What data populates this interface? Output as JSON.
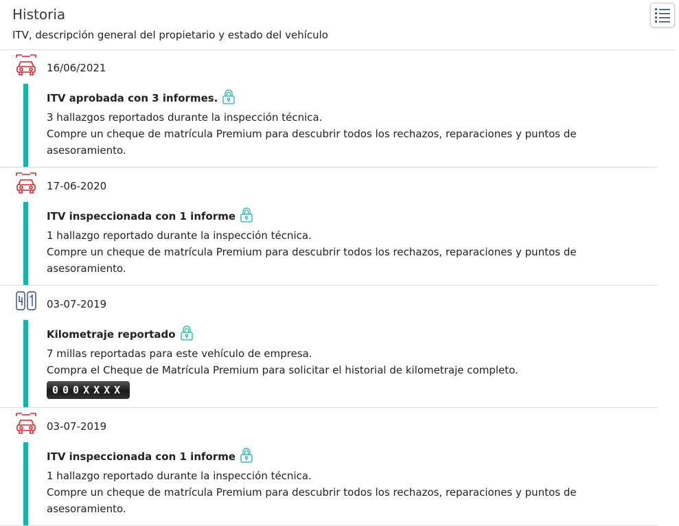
{
  "header": {
    "title": "Historia",
    "subtitle": "ITV, descripción general del propietario y estado del vehículo"
  },
  "colors": {
    "accent": "#1bb3a3",
    "icon_red": "#e0212a",
    "lock": "#1bb3a3"
  },
  "entries": [
    {
      "icon": "car-repair-icon",
      "date": "16/06/2021",
      "heading": "ITV aprobada con 3 informes.",
      "lines": [
        "3 hallazgos reportados durante la inspección técnica.",
        "Compre un cheque de matrícula Premium para descubrir todos los rechazos, reparaciones y puntos de asesoramiento."
      ]
    },
    {
      "icon": "car-repair-icon",
      "date": "17-06-2020",
      "heading": "ITV inspeccionada con 1 informe",
      "lines": [
        "1 hallazgo reportado durante la inspección técnica.",
        "Compre un cheque de matrícula Premium para descubrir todos los rechazos, reparaciones y puntos de asesoramiento."
      ]
    },
    {
      "icon": "odometer-icon",
      "date": "03-07-2019",
      "heading": "Kilometraje reportado",
      "lines": [
        "7 millas reportadas para este vehículo de empresa.",
        "Compra el Cheque de Matrícula Premium para solicitar el historial de kilometraje completo."
      ],
      "odometer": "000XXXX"
    },
    {
      "icon": "car-repair-icon",
      "date": "03-07-2019",
      "heading": "ITV inspeccionada con 1 informe",
      "lines": [
        "1 hallazgo reportado durante la inspección técnica.",
        "Compre un cheque de matrícula Premium para descubrir todos los rechazos, reparaciones y puntos de asesoramiento."
      ]
    }
  ]
}
